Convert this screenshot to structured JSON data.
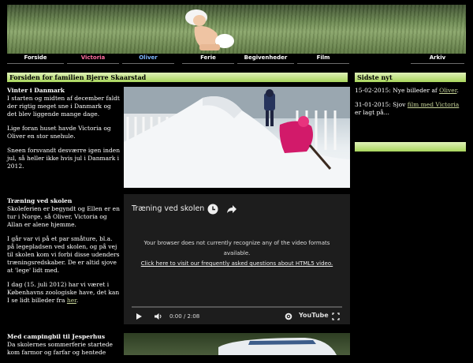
{
  "nav": {
    "items": [
      {
        "label": "Forside",
        "color": "#ffffff"
      },
      {
        "label": "Victoria",
        "color": "#ff6fa0"
      },
      {
        "label": "Oliver",
        "color": "#7fb8ff"
      },
      {
        "label": "Ferie",
        "color": "#ffffff"
      },
      {
        "label": "Begivenheder",
        "color": "#ffffff"
      },
      {
        "label": "Film",
        "color": "#ffffff"
      },
      {
        "label": "Arkiv",
        "color": "#ffffff"
      }
    ]
  },
  "main": {
    "header": "Forsiden for familien Bjerre Skaarstad",
    "articles": [
      {
        "title": "Vinter i Danmark",
        "paragraphs": [
          "I starten og midten af december faldt der rigtig meget sne i Danmark og det blev liggende mange dage.",
          "Lige foran huset havde Victoria og Oliver en stor snehule.",
          "Sneen forsvandt desværre igen inden jul, så heller ikke hvis jul i Danmark i 2012."
        ]
      },
      {
        "title": "Træning ved skolen",
        "paragraphs": [
          "Skoleferien er begyndt og Ellen er en tur i Norge, så Oliver, Victoria og Allan er alene hjemme.",
          "I går var vi på et par småture, bl.a. på legepladsen ved skolen, og på vej til skolen kom vi forbi disse udenders træningsredskaber. De er altid sjove at 'lege' lidt med.",
          "I dag (15. juli 2012) har vi været i Københavns zoologiske have, det kan I se lidt billeder fra"
        ],
        "link": "her",
        "link_suffix": "."
      },
      {
        "title": "Med campingbil til Jesperhus",
        "paragraphs": [
          "Da skolernes sommerferie startede kom farmor og farfar og hentede"
        ]
      }
    ],
    "video": {
      "title": "Træning ved skolen",
      "message_line1": "Your browser does not currently recognize any of the video formats available.",
      "message_link": "Click here to visit our frequently asked questions about HTML5 video.",
      "time": "0:00 / 2:08",
      "brand": "YouTube"
    }
  },
  "sidebar": {
    "header": "Sidste nyt",
    "news": [
      {
        "date": "15-02-2015:",
        "text": "Nye billeder af",
        "link": "Oliver",
        "suffix": "."
      },
      {
        "date": "31-01-2015:",
        "text": "Sjov",
        "link": "film med Victoria",
        "suffix": "er lagt på..."
      }
    ]
  }
}
